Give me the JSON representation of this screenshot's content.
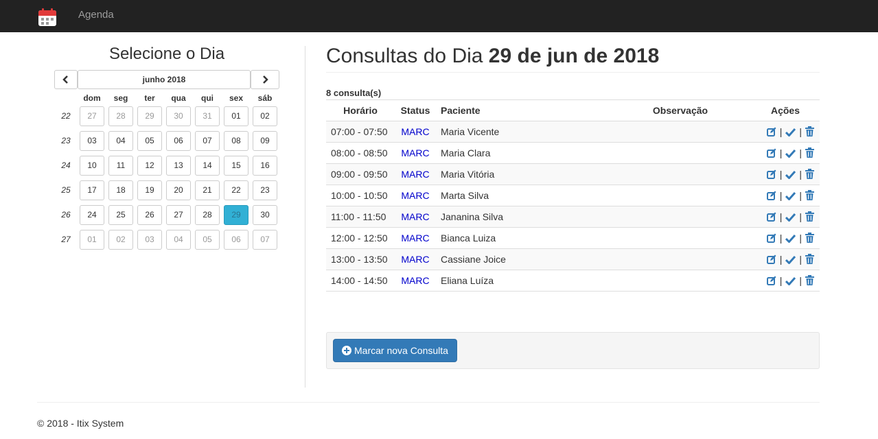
{
  "navbar": {
    "brand": "Agenda",
    "icon": "calendar-icon"
  },
  "sidebar": {
    "title": "Selecione o Dia",
    "month_label": "junho 2018",
    "dows": [
      "dom",
      "seg",
      "ter",
      "qua",
      "qui",
      "sex",
      "sáb"
    ],
    "weeks": [
      {
        "num": "22",
        "days": [
          [
            "27",
            1
          ],
          [
            "28",
            1
          ],
          [
            "29",
            1
          ],
          [
            "30",
            1
          ],
          [
            "31",
            1
          ],
          [
            "01",
            0
          ],
          [
            "02",
            0
          ]
        ]
      },
      {
        "num": "23",
        "days": [
          [
            "03",
            0
          ],
          [
            "04",
            0
          ],
          [
            "05",
            0
          ],
          [
            "06",
            0
          ],
          [
            "07",
            0
          ],
          [
            "08",
            0
          ],
          [
            "09",
            0
          ]
        ]
      },
      {
        "num": "24",
        "days": [
          [
            "10",
            0
          ],
          [
            "11",
            0
          ],
          [
            "12",
            0
          ],
          [
            "13",
            0
          ],
          [
            "14",
            0
          ],
          [
            "15",
            0
          ],
          [
            "16",
            0
          ]
        ]
      },
      {
        "num": "25",
        "days": [
          [
            "17",
            0
          ],
          [
            "18",
            0
          ],
          [
            "19",
            0
          ],
          [
            "20",
            0
          ],
          [
            "21",
            0
          ],
          [
            "22",
            0
          ],
          [
            "23",
            0
          ]
        ]
      },
      {
        "num": "26",
        "days": [
          [
            "24",
            0
          ],
          [
            "25",
            0
          ],
          [
            "26",
            0
          ],
          [
            "27",
            0
          ],
          [
            "28",
            0
          ],
          [
            "29",
            2
          ],
          [
            "30",
            0
          ]
        ]
      },
      {
        "num": "27",
        "days": [
          [
            "01",
            1
          ],
          [
            "02",
            1
          ],
          [
            "03",
            1
          ],
          [
            "04",
            1
          ],
          [
            "05",
            1
          ],
          [
            "06",
            1
          ],
          [
            "07",
            1
          ]
        ]
      }
    ]
  },
  "main": {
    "title_prefix": "Consultas do Dia ",
    "title_date": "29 de jun de 2018",
    "count": "8 consulta(s)",
    "columns": {
      "time": "Horário",
      "status": "Status",
      "patient": "Paciente",
      "note": "Observação",
      "actions": "Ações"
    },
    "rows": [
      {
        "time": "07:00 - 07:50",
        "status": "MARC",
        "patient": "Maria Vicente",
        "note": ""
      },
      {
        "time": "08:00 - 08:50",
        "status": "MARC",
        "patient": "Maria Clara",
        "note": ""
      },
      {
        "time": "09:00 - 09:50",
        "status": "MARC",
        "patient": "Maria Vitória",
        "note": ""
      },
      {
        "time": "10:00 - 10:50",
        "status": "MARC",
        "patient": "Marta Silva",
        "note": ""
      },
      {
        "time": "11:00 - 11:50",
        "status": "MARC",
        "patient": "Jananina Silva",
        "note": ""
      },
      {
        "time": "12:00 - 12:50",
        "status": "MARC",
        "patient": "Bianca Luiza",
        "note": ""
      },
      {
        "time": "13:00 - 13:50",
        "status": "MARC",
        "patient": "Cassiane Joice",
        "note": ""
      },
      {
        "time": "14:00 - 14:50",
        "status": "MARC",
        "patient": "Eliana Luíza",
        "note": ""
      }
    ],
    "new_button": "Marcar nova Consulta"
  },
  "footer": {
    "text": "© 2018 - Itix System"
  },
  "colors": {
    "accent": "#337ab7",
    "active_day": "#31b0d5",
    "status": "#0000cc",
    "navbar": "#222222"
  }
}
